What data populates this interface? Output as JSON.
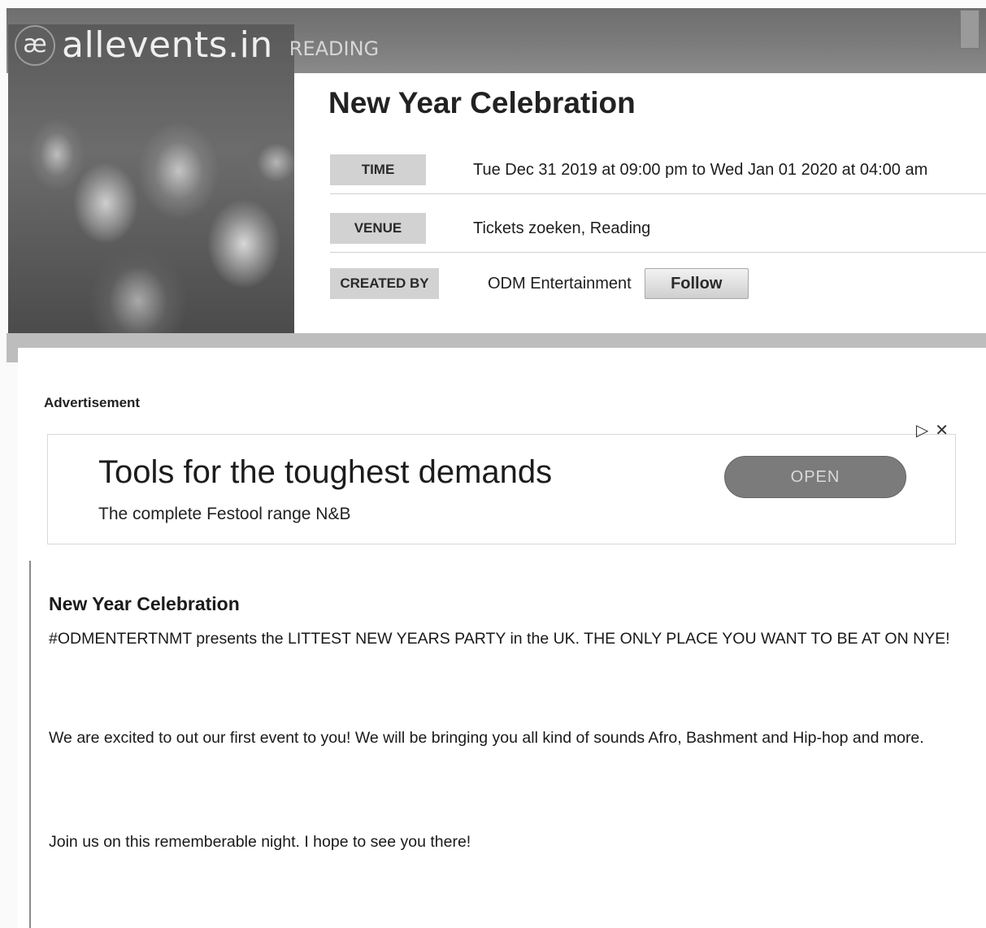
{
  "header": {
    "logo_mark": "æ",
    "logo_text": "allevents.in",
    "city": "READING"
  },
  "event": {
    "title": "New Year Celebration",
    "time_label": "TIME",
    "time_value": "Tue Dec 31 2019 at 09:00 pm to Wed Jan 01 2020 at 04:00 am",
    "venue_label": "VENUE",
    "venue_value": "Tickets zoeken, Reading",
    "created_by_label": "CREATED BY",
    "created_by_value": "ODM Entertainment",
    "follow_label": "Follow"
  },
  "ad": {
    "label": "Advertisement",
    "choices_icon": "▷",
    "close_icon": "✕",
    "headline": "Tools for the toughest demands",
    "subline": "The complete Festool range N&B",
    "cta": "OPEN"
  },
  "description": {
    "title": "New Year Celebration",
    "paragraphs": [
      "#ODMENTERTNMT presents the LITTEST NEW YEARS PARTY in the UK. THE ONLY PLACE YOU WANT TO BE AT ON NYE!",
      "We are excited to out our first event to you! We will be bringing you all kind of sounds Afro, Bashment and Hip-hop and more.",
      "Join us on this rememberable night. I hope to see you there!"
    ]
  }
}
